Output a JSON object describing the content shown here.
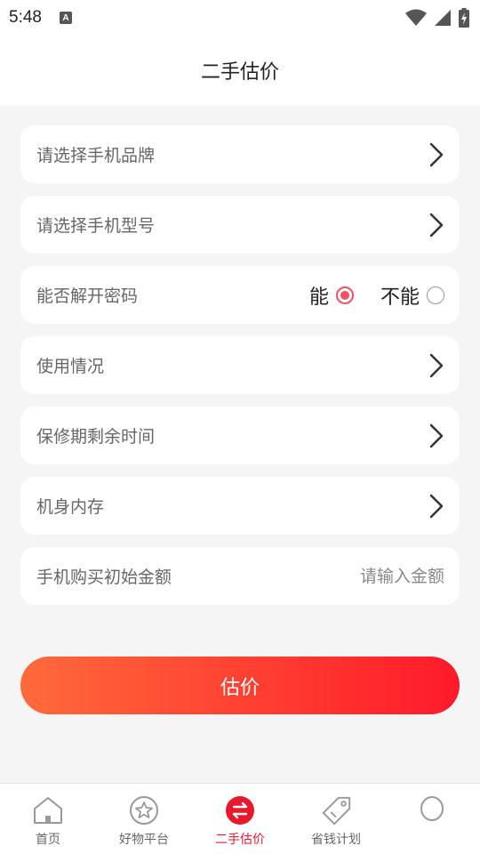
{
  "status_bar": {
    "time": "5:48",
    "notif_letter": "A"
  },
  "header": {
    "title": "二手估价"
  },
  "form": {
    "brand": {
      "label": "请选择手机品牌"
    },
    "model": {
      "label": "请选择手机型号"
    },
    "unlock": {
      "label": "能否解开密码",
      "options": [
        "能",
        "不能"
      ],
      "selected": "能"
    },
    "usage": {
      "label": "使用情况"
    },
    "warranty": {
      "label": "保修期剩余时间"
    },
    "storage": {
      "label": "机身内存"
    },
    "price": {
      "label": "手机购买初始金额",
      "value": "",
      "placeholder": "请输入金额"
    }
  },
  "estimate_button": {
    "label": "估价"
  },
  "tabbar": {
    "items": [
      {
        "label": "首页",
        "icon": "home-icon"
      },
      {
        "label": "好物平台",
        "icon": "star-icon"
      },
      {
        "label": "二手估价",
        "icon": "exchange-icon",
        "active": true
      },
      {
        "label": "省钱计划",
        "icon": "tag-icon"
      },
      {
        "label": "",
        "icon": "circle-icon"
      }
    ]
  },
  "colors": {
    "accent": "#e8192c",
    "radio": "#f05060",
    "button_start": "#ff6a3a",
    "button_end": "#ff1a2a"
  }
}
